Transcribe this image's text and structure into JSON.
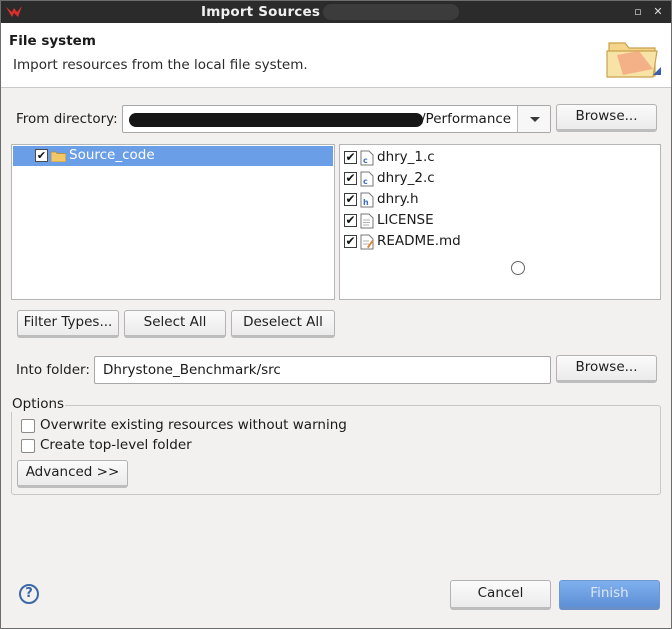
{
  "window": {
    "title": "Import Sources"
  },
  "banner": {
    "title": "File system",
    "description": "Import resources from the local file system.",
    "icon": "folder-import-icon"
  },
  "from_directory": {
    "label": "From directory:",
    "value_visible": "/Performance",
    "browse_label": "Browse..."
  },
  "tree": {
    "items": [
      {
        "label": "Source_code",
        "checked": true,
        "selected": true
      }
    ]
  },
  "files": [
    {
      "name": "dhry_1.c",
      "checked": true,
      "icon": "c-source-file-icon"
    },
    {
      "name": "dhry_2.c",
      "checked": true,
      "icon": "c-source-file-icon"
    },
    {
      "name": "dhry.h",
      "checked": true,
      "icon": "c-header-file-icon"
    },
    {
      "name": "LICENSE",
      "checked": true,
      "icon": "text-file-icon"
    },
    {
      "name": "README.md",
      "checked": true,
      "icon": "markdown-file-icon"
    }
  ],
  "selection_buttons": {
    "filter": "Filter Types...",
    "select_all": "Select All",
    "deselect_all": "Deselect All"
  },
  "into_folder": {
    "label": "Into folder:",
    "value": "Dhrystone_Benchmark/src",
    "browse_label": "Browse..."
  },
  "options": {
    "title": "Options",
    "overwrite": {
      "label": "Overwrite existing resources without warning",
      "checked": false
    },
    "top_level": {
      "label": "Create top-level folder",
      "checked": false
    },
    "advanced_label": "Advanced >>"
  },
  "footer": {
    "help": "?",
    "cancel": "Cancel",
    "finish": "Finish"
  },
  "colors": {
    "selection": "#6a9ee6",
    "finish_button": "#6e9fe3",
    "titlebar": "#2b2b2b"
  }
}
